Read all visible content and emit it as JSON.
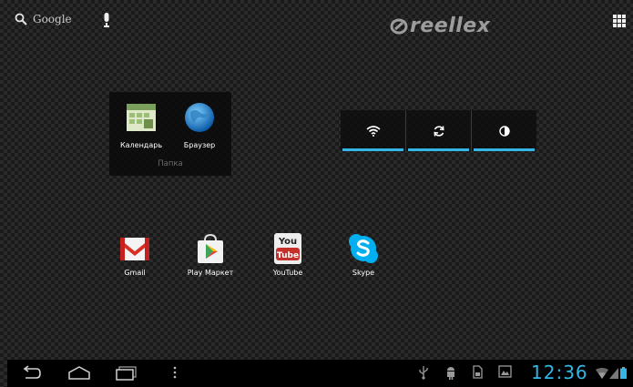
{
  "topbar": {
    "search_label": "Google",
    "brand": "reellex"
  },
  "folder": {
    "name": "Папка",
    "items": [
      {
        "label": "Календарь",
        "icon": "calendar-icon"
      },
      {
        "label": "Браузер",
        "icon": "globe-icon"
      }
    ]
  },
  "widget": {
    "buttons": [
      "wifi-icon",
      "sync-icon",
      "brightness-icon"
    ]
  },
  "apps": [
    {
      "label": "Gmail",
      "icon": "gmail-icon"
    },
    {
      "label": "Play Маркет",
      "icon": "play-store-icon"
    },
    {
      "label": "YouTube",
      "icon": "youtube-icon",
      "logo_text_1": "You",
      "logo_text_2": "Tube"
    },
    {
      "label": "Skype",
      "icon": "skype-icon"
    }
  ],
  "statusbar": {
    "time": "12:36"
  },
  "colors": {
    "accent": "#33b5e5",
    "youtube_red": "#c4302b",
    "skype_blue": "#00aff0"
  }
}
